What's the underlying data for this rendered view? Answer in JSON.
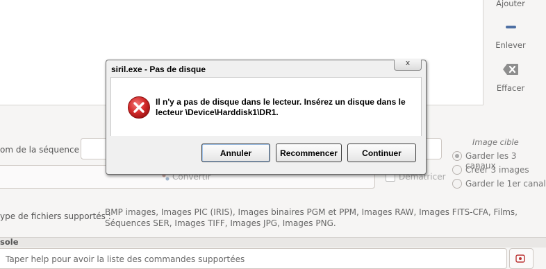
{
  "app": {
    "sidebar": {
      "add_label": "Ajouter",
      "remove_label": "Enlever",
      "clear_label": "Effacer"
    },
    "sequence_label": "om de la séquence :",
    "convert_label": "Convertir",
    "debayer_label": "Dématricer",
    "image_target": {
      "title": "Image cible",
      "options": [
        "Garder les 3 canaux",
        "Créer 3 images",
        "Garder le 1er canal"
      ],
      "selected_index": 0
    },
    "file_types_label": "ype de fichiers supportés :",
    "file_types_text": "BMP images, Images PIC (IRIS), Images binaires PGM et PPM, Images RAW, Images FITS-CFA, Films, Séquences SER, Images TIFF, Images JPG, Images PNG.",
    "console_label": "sole",
    "command_input_text": "Taper help pour avoir la liste des commandes supportées"
  },
  "dialog": {
    "title": "siril.exe - Pas de disque",
    "close_symbol": "x",
    "message": "Il n'y a pas de disque dans le lecteur. Insérez un disque dans le lecteur \\Device\\Harddisk1\\DR1.",
    "buttons": {
      "cancel": "Annuler",
      "retry": "Recommencer",
      "continue": "Continuer"
    },
    "icon": "error-icon"
  },
  "colors": {
    "error_red": "#d42b2b",
    "accent_blue": "#4d6fa3"
  }
}
